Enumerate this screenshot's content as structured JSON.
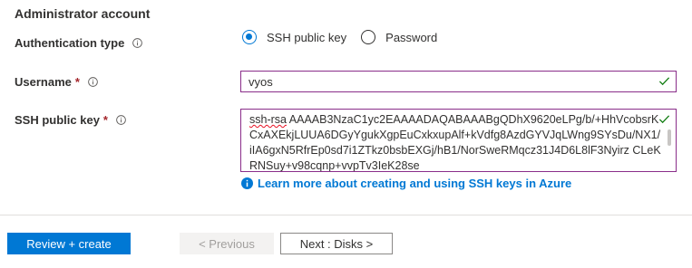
{
  "section": {
    "title": "Administrator account"
  },
  "auth": {
    "label": "Authentication type",
    "options": [
      {
        "label": "SSH public key",
        "selected": true
      },
      {
        "label": "Password",
        "selected": false
      }
    ]
  },
  "username": {
    "label": "Username",
    "required_mark": "*",
    "value": "vyos"
  },
  "ssh_key": {
    "label": "SSH public key",
    "required_mark": "*",
    "value_prefix": "ssh-rsa",
    "value_rest": " AAAAB3NzaC1yc2EAAAADAQABAAABgQDhX9620eLPg/b/+HhVcobsrKCxAXEkjLUUA6DGyYgukXgpEuCxkxupAlf+kVdfg8AzdGYVJqLWng9SYsDu/NX1/iIA6gxN5RfrEp0sd7i1ZTkz0bsbEXGj/hB1/NorSweRMqcz31J4D6L8lF3Nyirz CLeKRNSuy+v98cqnp+vvpTv3IeK28se"
  },
  "learn_more": {
    "label": "Learn more about creating and using SSH keys in Azure"
  },
  "footer": {
    "review_label": "Review + create",
    "previous_label": "< Previous",
    "next_label": "Next : Disks >"
  },
  "colors": {
    "accent": "#0078d4",
    "valid": "#107c10",
    "field_border": "#8a2d8a",
    "required": "#a4262c"
  },
  "icons": {
    "info": "info-icon",
    "check": "checkmark-icon",
    "learn": "info-filled-icon"
  }
}
